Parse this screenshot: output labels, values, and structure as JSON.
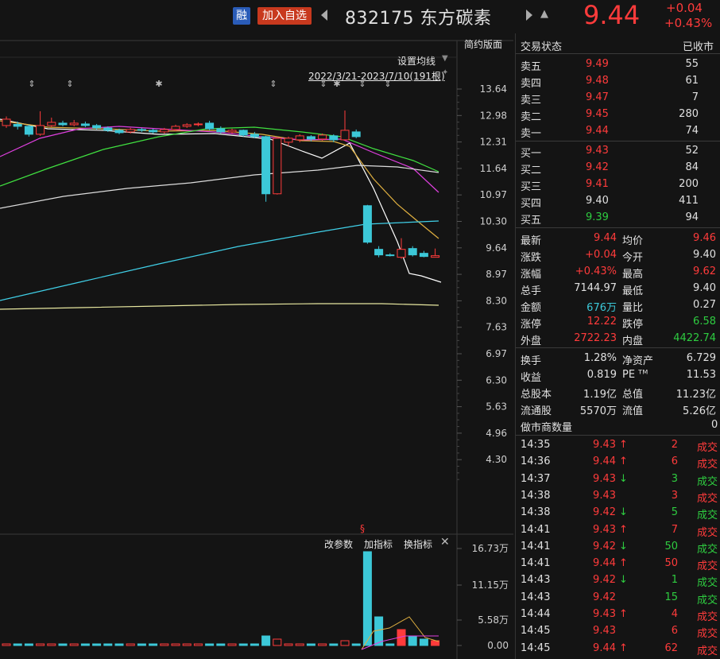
{
  "header": {
    "rong_label": "融",
    "add_watch_label": "加入自选",
    "stock_code": "832175",
    "stock_name": "东方碳素",
    "price": "9.44",
    "change": "+0.04",
    "change_pct": "+0.43%"
  },
  "chart": {
    "top_label": "简约版面",
    "ma_setting": "设置均线",
    "date_range": "2022/3/21-2023/7/10(191根)",
    "price_ticks": [
      "13.64",
      "12.98",
      "12.31",
      "11.64",
      "10.97",
      "10.30",
      "9.64",
      "8.97",
      "8.30",
      "7.63",
      "6.97",
      "6.30",
      "5.63",
      "4.96",
      "4.30"
    ],
    "volume_ticks": [
      "16.73万",
      "11.15万",
      "5.58万",
      "0.00"
    ],
    "toolbar": {
      "params": "改参数",
      "add_indicator": "加指标",
      "switch_indicator": "换指标"
    },
    "candles": [
      {
        "o": 12.72,
        "c": 12.88,
        "h": 12.95,
        "l": 12.66
      },
      {
        "o": 12.75,
        "c": 12.7,
        "h": 12.82,
        "l": 12.62
      },
      {
        "o": 12.7,
        "c": 12.5,
        "h": 12.74,
        "l": 12.44
      },
      {
        "o": 12.5,
        "c": 12.72,
        "h": 13.08,
        "l": 12.46
      },
      {
        "o": 12.72,
        "c": 12.8,
        "h": 12.92,
        "l": 12.68
      },
      {
        "o": 12.78,
        "c": 12.74,
        "h": 12.84,
        "l": 12.7
      },
      {
        "o": 12.74,
        "c": 12.78,
        "h": 12.86,
        "l": 12.7
      },
      {
        "o": 12.76,
        "c": 12.72,
        "h": 12.82,
        "l": 12.68
      },
      {
        "o": 12.72,
        "c": 12.66,
        "h": 12.76,
        "l": 12.62
      },
      {
        "o": 12.66,
        "c": 12.6,
        "h": 12.7,
        "l": 12.56
      },
      {
        "o": 12.6,
        "c": 12.54,
        "h": 12.64,
        "l": 12.5
      },
      {
        "o": 12.56,
        "c": 12.62,
        "h": 12.66,
        "l": 12.52
      },
      {
        "o": 12.62,
        "c": 12.6,
        "h": 12.66,
        "l": 12.56
      },
      {
        "o": 12.6,
        "c": 12.56,
        "h": 12.64,
        "l": 12.52
      },
      {
        "o": 12.56,
        "c": 12.62,
        "h": 12.66,
        "l": 12.52
      },
      {
        "o": 12.62,
        "c": 12.7,
        "h": 12.74,
        "l": 12.58
      },
      {
        "o": 12.7,
        "c": 12.74,
        "h": 12.78,
        "l": 12.66
      },
      {
        "o": 12.74,
        "c": 12.76,
        "h": 12.8,
        "l": 12.7
      },
      {
        "o": 12.78,
        "c": 12.64,
        "h": 12.84,
        "l": 12.6
      },
      {
        "o": 12.64,
        "c": 12.56,
        "h": 12.7,
        "l": 12.52
      },
      {
        "o": 12.56,
        "c": 12.6,
        "h": 12.64,
        "l": 12.52
      },
      {
        "o": 12.6,
        "c": 12.48,
        "h": 12.62,
        "l": 12.44
      },
      {
        "o": 12.5,
        "c": 12.44,
        "h": 12.56,
        "l": 12.4
      },
      {
        "o": 12.44,
        "c": 11.0,
        "h": 12.46,
        "l": 10.8
      },
      {
        "o": 11.0,
        "c": 12.4,
        "h": 12.42,
        "l": 10.98
      },
      {
        "o": 12.3,
        "c": 12.4,
        "h": 12.44,
        "l": 12.2
      },
      {
        "o": 12.36,
        "c": 12.46,
        "h": 12.5,
        "l": 12.3
      },
      {
        "o": 12.44,
        "c": 12.38,
        "h": 12.48,
        "l": 12.32
      },
      {
        "o": 12.38,
        "c": 12.48,
        "h": 12.52,
        "l": 12.34
      },
      {
        "o": 12.46,
        "c": 12.36,
        "h": 12.5,
        "l": 12.3
      },
      {
        "o": 12.36,
        "c": 12.6,
        "h": 13.1,
        "l": 12.34
      },
      {
        "o": 12.56,
        "c": 12.44,
        "h": 12.62,
        "l": 12.4
      },
      {
        "o": 10.7,
        "c": 9.78,
        "h": 10.72,
        "l": 9.74
      },
      {
        "o": 9.6,
        "c": 9.46,
        "h": 9.68,
        "l": 9.4
      },
      {
        "o": 9.46,
        "c": 9.44,
        "h": 9.5,
        "l": 9.42
      },
      {
        "o": 9.4,
        "c": 9.6,
        "h": 9.88,
        "l": 9.36
      },
      {
        "o": 9.62,
        "c": 9.46,
        "h": 9.68,
        "l": 9.42
      },
      {
        "o": 9.5,
        "c": 9.42,
        "h": 9.56,
        "l": 9.4
      },
      {
        "o": 9.4,
        "c": 9.44,
        "h": 9.62,
        "l": 9.4
      }
    ]
  },
  "panel": {
    "status_label": "交易状态",
    "status_value": "已收市",
    "asks": [
      {
        "label": "卖五",
        "price": "9.49",
        "vol": "55"
      },
      {
        "label": "卖四",
        "price": "9.48",
        "vol": "61"
      },
      {
        "label": "卖三",
        "price": "9.47",
        "vol": "7"
      },
      {
        "label": "卖二",
        "price": "9.45",
        "vol": "280"
      },
      {
        "label": "卖一",
        "price": "9.44",
        "vol": "74"
      }
    ],
    "bids": [
      {
        "label": "买一",
        "price": "9.43",
        "vol": "52",
        "color": "red"
      },
      {
        "label": "买二",
        "price": "9.42",
        "vol": "84",
        "color": "red"
      },
      {
        "label": "买三",
        "price": "9.41",
        "vol": "200",
        "color": "red"
      },
      {
        "label": "买四",
        "price": "9.40",
        "vol": "411",
        "color": "white"
      },
      {
        "label": "买五",
        "price": "9.39",
        "vol": "94",
        "color": "green"
      }
    ],
    "stats": [
      {
        "l1": "最新",
        "v1": "9.44",
        "c1": "red",
        "l2": "均价",
        "v2": "9.46",
        "c2": "red"
      },
      {
        "l1": "涨跌",
        "v1": "+0.04",
        "c1": "red",
        "l2": "今开",
        "v2": "9.40",
        "c2": "white"
      },
      {
        "l1": "涨幅",
        "v1": "+0.43%",
        "c1": "red",
        "l2": "最高",
        "v2": "9.62",
        "c2": "red"
      },
      {
        "l1": "总手",
        "v1": "7144.97",
        "c1": "white",
        "l2": "最低",
        "v2": "9.40",
        "c2": "white"
      },
      {
        "l1": "金额",
        "v1": "676万",
        "c1": "cyan",
        "l2": "量比",
        "v2": "0.27",
        "c2": "white"
      },
      {
        "l1": "涨停",
        "v1": "12.22",
        "c1": "red",
        "l2": "跌停",
        "v2": "6.58",
        "c2": "green"
      },
      {
        "l1": "外盘",
        "v1": "2722.23",
        "c1": "red",
        "l2": "内盘",
        "v2": "4422.74",
        "c2": "green"
      }
    ],
    "fundamentals": [
      {
        "l1": "换手",
        "v1": "1.28%",
        "l2": "净资产",
        "v2": "6.729"
      },
      {
        "l1": "收益",
        "v1": "0.819",
        "l2": "PE ᵀᴹ",
        "v2": "11.53"
      },
      {
        "l1": "总股本",
        "v1": "1.19亿",
        "l2": "总值",
        "v2": "11.23亿"
      },
      {
        "l1": "流通股",
        "v1": "5570万",
        "l2": "流值",
        "v2": "5.26亿"
      }
    ],
    "market_maker_label": "做市商数量",
    "market_maker_value": "0",
    "trades": [
      {
        "time": "14:35",
        "price": "9.43",
        "dir": "↑",
        "vol": "2",
        "vc": "red",
        "type": "成交",
        "tc": "red"
      },
      {
        "time": "14:36",
        "price": "9.44",
        "dir": "↑",
        "vol": "6",
        "vc": "red",
        "type": "成交",
        "tc": "red"
      },
      {
        "time": "14:37",
        "price": "9.43",
        "dir": "↓",
        "vol": "3",
        "vc": "green",
        "type": "成交",
        "tc": "green"
      },
      {
        "time": "14:38",
        "price": "9.43",
        "dir": "",
        "vol": "3",
        "vc": "red",
        "type": "成交",
        "tc": "red"
      },
      {
        "time": "14:38",
        "price": "9.42",
        "dir": "↓",
        "vol": "5",
        "vc": "green",
        "type": "成交",
        "tc": "green"
      },
      {
        "time": "14:41",
        "price": "9.43",
        "dir": "↑",
        "vol": "7",
        "vc": "red",
        "type": "成交",
        "tc": "red"
      },
      {
        "time": "14:41",
        "price": "9.42",
        "dir": "↓",
        "vol": "50",
        "vc": "green",
        "type": "成交",
        "tc": "green"
      },
      {
        "time": "14:41",
        "price": "9.44",
        "dir": "↑",
        "vol": "50",
        "vc": "red",
        "type": "成交",
        "tc": "red"
      },
      {
        "time": "14:43",
        "price": "9.42",
        "dir": "↓",
        "vol": "1",
        "vc": "green",
        "type": "成交",
        "tc": "green"
      },
      {
        "time": "14:43",
        "price": "9.42",
        "dir": "",
        "vol": "15",
        "vc": "green",
        "type": "成交",
        "tc": "green"
      },
      {
        "time": "14:44",
        "price": "9.43",
        "dir": "↑",
        "vol": "4",
        "vc": "red",
        "type": "成交",
        "tc": "red"
      },
      {
        "time": "14:45",
        "price": "9.43",
        "dir": "",
        "vol": "6",
        "vc": "red",
        "type": "成交",
        "tc": "red"
      },
      {
        "time": "14:45",
        "price": "9.44",
        "dir": "↑",
        "vol": "62",
        "vc": "red",
        "type": "成交",
        "tc": "red"
      }
    ]
  }
}
